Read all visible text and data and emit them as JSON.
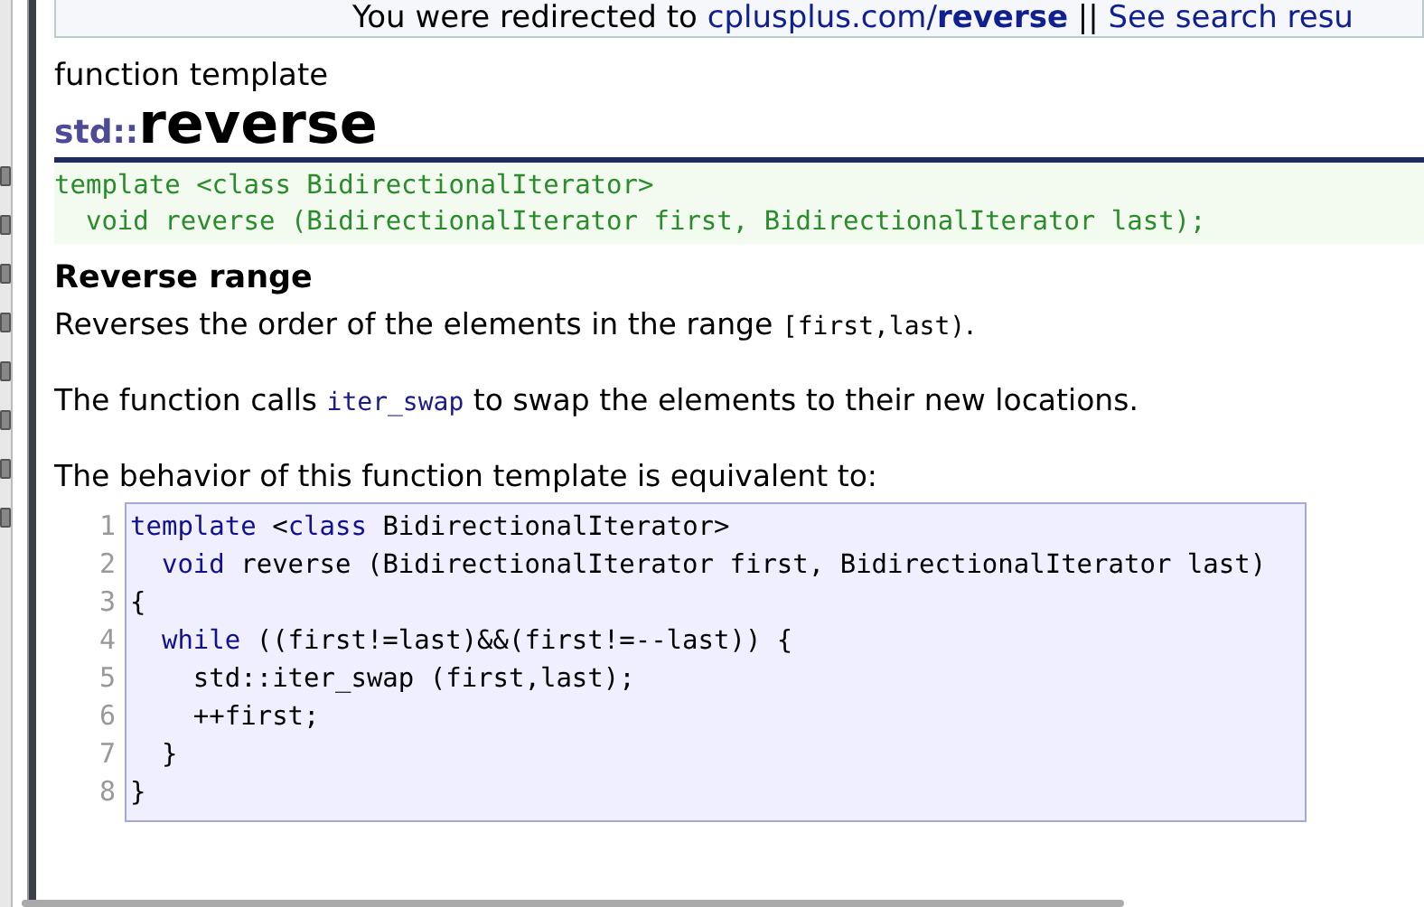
{
  "banner": {
    "segments": [
      {
        "kind": "text",
        "text": "You were redirected to "
      },
      {
        "kind": "link",
        "text": "cplusplus.com/"
      },
      {
        "kind": "link-bold",
        "text": "reverse"
      },
      {
        "kind": "text",
        "text": " || "
      },
      {
        "kind": "link",
        "text": "See search resu"
      }
    ]
  },
  "kind_label": "function template",
  "title": {
    "namespace": "std::",
    "name": "reverse"
  },
  "prototype": [
    "template <class BidirectionalIterator>",
    "  void reverse (BidirectionalIterator first, BidirectionalIterator last);"
  ],
  "heading": "Reverse range",
  "paragraphs": [
    {
      "segments": [
        {
          "kind": "text",
          "text": "Reverses the order of the elements in the range "
        },
        {
          "kind": "code",
          "text": "[first,last)"
        },
        {
          "kind": "text",
          "text": "."
        }
      ]
    },
    {
      "segments": [
        {
          "kind": "text",
          "text": "The function calls "
        },
        {
          "kind": "code-link",
          "text": "iter_swap"
        },
        {
          "kind": "text",
          "text": " to swap the elements to their new locations."
        }
      ]
    },
    {
      "segments": [
        {
          "kind": "text",
          "text": "The behavior of this function template is equivalent to:"
        }
      ]
    }
  ],
  "code": [
    {
      "number": "1",
      "segments": [
        {
          "kind": "keyword",
          "text": "template"
        },
        {
          "kind": "plain",
          "text": " <"
        },
        {
          "kind": "keyword",
          "text": "class"
        },
        {
          "kind": "plain",
          "text": " BidirectionalIterator>"
        }
      ]
    },
    {
      "number": "2",
      "segments": [
        {
          "kind": "keyword",
          "text": "  void"
        },
        {
          "kind": "plain",
          "text": " reverse (BidirectionalIterator first, BidirectionalIterator last)"
        }
      ]
    },
    {
      "number": "3",
      "segments": [
        {
          "kind": "plain",
          "text": "{"
        }
      ]
    },
    {
      "number": "4",
      "segments": [
        {
          "kind": "keyword",
          "text": "  while"
        },
        {
          "kind": "plain",
          "text": " ((first!=last)&&(first!=--last)) {"
        }
      ]
    },
    {
      "number": "5",
      "segments": [
        {
          "kind": "plain",
          "text": "    std::iter_swap (first,last);"
        }
      ]
    },
    {
      "number": "6",
      "segments": [
        {
          "kind": "plain",
          "text": "    ++first;"
        }
      ]
    },
    {
      "number": "7",
      "segments": [
        {
          "kind": "plain",
          "text": "  }"
        }
      ]
    },
    {
      "number": "8",
      "segments": [
        {
          "kind": "plain",
          "text": "}"
        }
      ]
    }
  ]
}
